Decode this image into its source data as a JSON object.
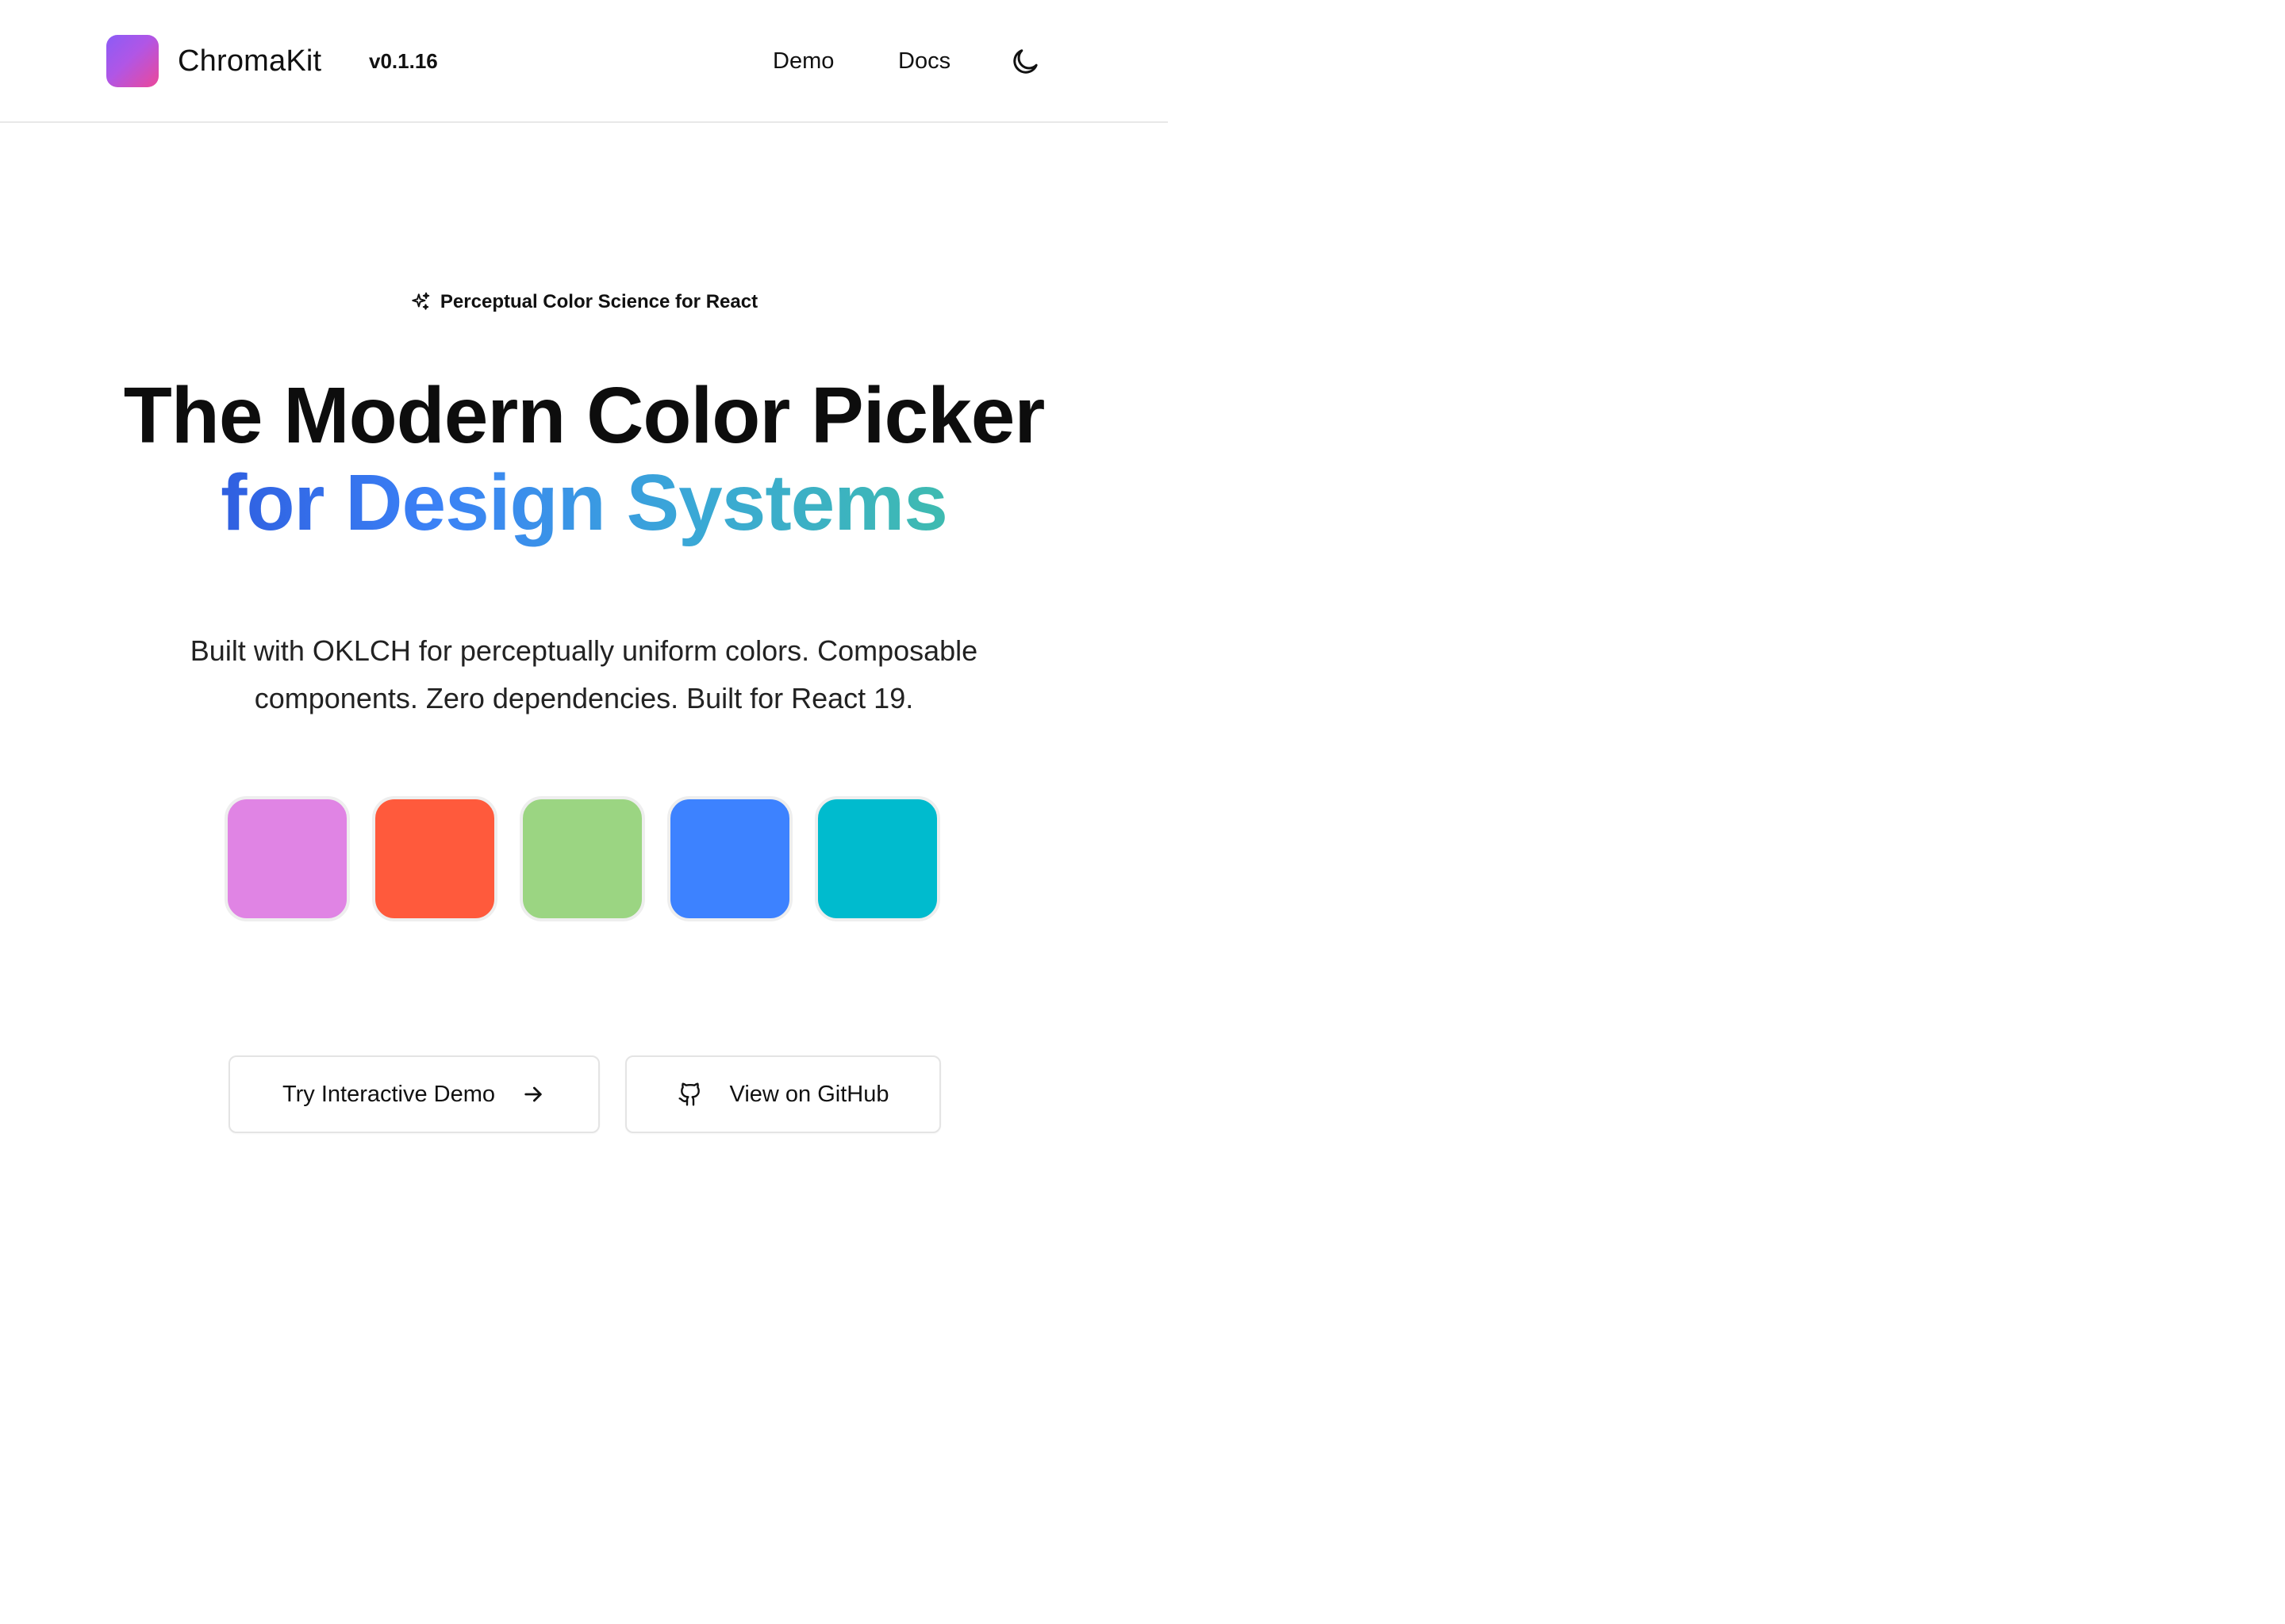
{
  "header": {
    "brand": "ChromaKit",
    "version": "v0.1.16",
    "nav": [
      {
        "label": "Demo"
      },
      {
        "label": "Docs"
      }
    ],
    "theme_icon": "moon-icon"
  },
  "hero": {
    "tagline": "Perceptual Color Science for React",
    "tagline_icon": "sparkles-icon",
    "title_line_1": "The Modern Color Picker",
    "title_line_2": "for Design Systems",
    "title_gradient": [
      "#2f5fe0",
      "#3b82f6",
      "#3aa8d6",
      "#3ebbb0"
    ],
    "subtitle": "Built with OKLCH for perceptually uniform colors. Composable components. Zero dependencies. Built for React 19."
  },
  "swatches": [
    {
      "color": "#e084e4"
    },
    {
      "color": "#ff5a3c"
    },
    {
      "color": "#9bd582"
    },
    {
      "color": "#3d82ff"
    },
    {
      "color": "#00bbce"
    }
  ],
  "actions": {
    "demo_label": "Try Interactive Demo",
    "demo_icon": "arrow-right-icon",
    "github_label": "View on GitHub",
    "github_icon": "github-icon"
  },
  "colors": {
    "logo_gradient": [
      "#8b5cf6",
      "#b056e6",
      "#ec4899"
    ],
    "border": "#e4e4e4",
    "text": "#111111"
  }
}
